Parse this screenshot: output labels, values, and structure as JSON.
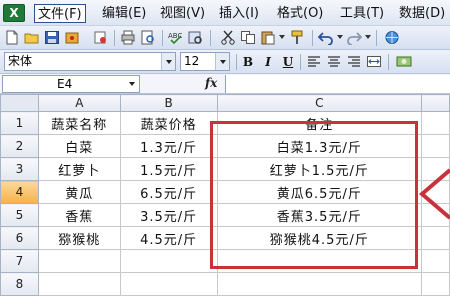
{
  "menubar": {
    "app_icon": "X",
    "items": [
      "文件(F)",
      "编辑(E)",
      "视图(V)",
      "插入(I)",
      "格式(O)",
      "工具(T)",
      "数据(D)"
    ]
  },
  "toolbar_standard": {
    "icons": [
      "new-icon",
      "open-icon",
      "save-icon",
      "permission-icon",
      "print-icon",
      "print-preview-icon",
      "spelling-icon",
      "research-icon",
      "cut-icon",
      "copy-icon",
      "paste-icon",
      "format-painter-icon",
      "undo-icon",
      "redo-icon"
    ]
  },
  "toolbar_format": {
    "font_name": "宋体",
    "font_size": "12",
    "bold": "B",
    "italic": "I",
    "underline": "U"
  },
  "formula_bar": {
    "cell_ref": "E4",
    "fx": "fx",
    "content": ""
  },
  "sheet": {
    "columns": [
      "A",
      "B",
      "C"
    ],
    "active_row": "4",
    "rows": [
      {
        "num": "1",
        "a": "蔬菜名称",
        "b": "蔬菜价格",
        "c": "备注"
      },
      {
        "num": "2",
        "a": "白菜",
        "b": "1.3元/斤",
        "c": "白菜1.3元/斤"
      },
      {
        "num": "3",
        "a": "红萝卜",
        "b": "1.5元/斤",
        "c": "红萝卜1.5元/斤"
      },
      {
        "num": "4",
        "a": "黄瓜",
        "b": "6.5元/斤",
        "c": "黄瓜6.5元/斤"
      },
      {
        "num": "5",
        "a": "香蕉",
        "b": "3.5元/斤",
        "c": "香蕉3.5元/斤"
      },
      {
        "num": "6",
        "a": "猕猴桃",
        "b": "4.5元/斤",
        "c": "猕猴桃4.5元/斤"
      },
      {
        "num": "7",
        "a": "",
        "b": "",
        "c": ""
      },
      {
        "num": "8",
        "a": "",
        "b": "",
        "c": ""
      }
    ]
  },
  "annotation": {
    "highlight_color": "#c8323d"
  }
}
